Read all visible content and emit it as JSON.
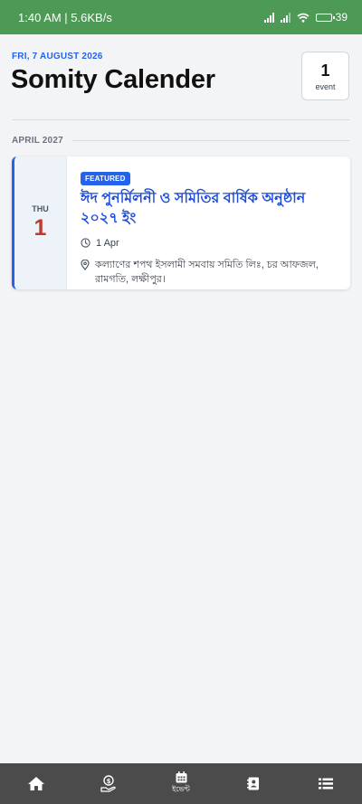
{
  "status_bar": {
    "time_speed": "1:40 AM | 5.6KB/s",
    "battery": "39",
    "battery_level": 0.39
  },
  "header": {
    "date_label": "FRI, 7 AUGUST 2026",
    "title": "Somity Calender",
    "event_count": "1",
    "event_count_label": "event"
  },
  "month_label": "APRIL 2027",
  "event": {
    "day_of_week": "THU",
    "day": "1",
    "badge": "FEATURED",
    "title": "ঈদ পুনর্মিলনী ও সমিতির বার্ষিক অনুষ্ঠান ২০২৭ ইং",
    "date": "1 Apr",
    "location": "কল্যাণের শপথ ইসলামী সমবায় সমিতি লিঃ, চর আফজল, রামগতি, লক্ষীপুর।",
    "accent_color": "#2563eb",
    "day_color": "#c0392b"
  },
  "bottom_nav": {
    "items": [
      {
        "icon": "home-icon",
        "label": ""
      },
      {
        "icon": "money-hand-icon",
        "label": ""
      },
      {
        "icon": "calendar-icon",
        "label": "ইভেন্ট"
      },
      {
        "icon": "contacts-book-icon",
        "label": ""
      },
      {
        "icon": "list-icon",
        "label": ""
      }
    ]
  }
}
